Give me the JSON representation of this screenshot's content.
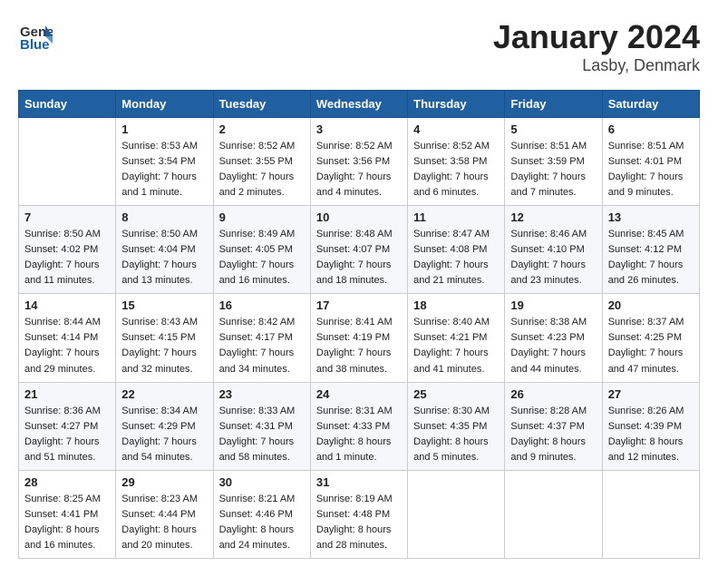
{
  "header": {
    "logo_line1": "General",
    "logo_line2": "Blue",
    "month": "January 2024",
    "location": "Lasby, Denmark"
  },
  "weekdays": [
    "Sunday",
    "Monday",
    "Tuesday",
    "Wednesday",
    "Thursday",
    "Friday",
    "Saturday"
  ],
  "weeks": [
    [
      {
        "day": "",
        "info": ""
      },
      {
        "day": "1",
        "info": "Sunrise: 8:53 AM\nSunset: 3:54 PM\nDaylight: 7 hours\nand 1 minute."
      },
      {
        "day": "2",
        "info": "Sunrise: 8:52 AM\nSunset: 3:55 PM\nDaylight: 7 hours\nand 2 minutes."
      },
      {
        "day": "3",
        "info": "Sunrise: 8:52 AM\nSunset: 3:56 PM\nDaylight: 7 hours\nand 4 minutes."
      },
      {
        "day": "4",
        "info": "Sunrise: 8:52 AM\nSunset: 3:58 PM\nDaylight: 7 hours\nand 6 minutes."
      },
      {
        "day": "5",
        "info": "Sunrise: 8:51 AM\nSunset: 3:59 PM\nDaylight: 7 hours\nand 7 minutes."
      },
      {
        "day": "6",
        "info": "Sunrise: 8:51 AM\nSunset: 4:01 PM\nDaylight: 7 hours\nand 9 minutes."
      }
    ],
    [
      {
        "day": "7",
        "info": "Sunrise: 8:50 AM\nSunset: 4:02 PM\nDaylight: 7 hours\nand 11 minutes."
      },
      {
        "day": "8",
        "info": "Sunrise: 8:50 AM\nSunset: 4:04 PM\nDaylight: 7 hours\nand 13 minutes."
      },
      {
        "day": "9",
        "info": "Sunrise: 8:49 AM\nSunset: 4:05 PM\nDaylight: 7 hours\nand 16 minutes."
      },
      {
        "day": "10",
        "info": "Sunrise: 8:48 AM\nSunset: 4:07 PM\nDaylight: 7 hours\nand 18 minutes."
      },
      {
        "day": "11",
        "info": "Sunrise: 8:47 AM\nSunset: 4:08 PM\nDaylight: 7 hours\nand 21 minutes."
      },
      {
        "day": "12",
        "info": "Sunrise: 8:46 AM\nSunset: 4:10 PM\nDaylight: 7 hours\nand 23 minutes."
      },
      {
        "day": "13",
        "info": "Sunrise: 8:45 AM\nSunset: 4:12 PM\nDaylight: 7 hours\nand 26 minutes."
      }
    ],
    [
      {
        "day": "14",
        "info": "Sunrise: 8:44 AM\nSunset: 4:14 PM\nDaylight: 7 hours\nand 29 minutes."
      },
      {
        "day": "15",
        "info": "Sunrise: 8:43 AM\nSunset: 4:15 PM\nDaylight: 7 hours\nand 32 minutes."
      },
      {
        "day": "16",
        "info": "Sunrise: 8:42 AM\nSunset: 4:17 PM\nDaylight: 7 hours\nand 34 minutes."
      },
      {
        "day": "17",
        "info": "Sunrise: 8:41 AM\nSunset: 4:19 PM\nDaylight: 7 hours\nand 38 minutes."
      },
      {
        "day": "18",
        "info": "Sunrise: 8:40 AM\nSunset: 4:21 PM\nDaylight: 7 hours\nand 41 minutes."
      },
      {
        "day": "19",
        "info": "Sunrise: 8:38 AM\nSunset: 4:23 PM\nDaylight: 7 hours\nand 44 minutes."
      },
      {
        "day": "20",
        "info": "Sunrise: 8:37 AM\nSunset: 4:25 PM\nDaylight: 7 hours\nand 47 minutes."
      }
    ],
    [
      {
        "day": "21",
        "info": "Sunrise: 8:36 AM\nSunset: 4:27 PM\nDaylight: 7 hours\nand 51 minutes."
      },
      {
        "day": "22",
        "info": "Sunrise: 8:34 AM\nSunset: 4:29 PM\nDaylight: 7 hours\nand 54 minutes."
      },
      {
        "day": "23",
        "info": "Sunrise: 8:33 AM\nSunset: 4:31 PM\nDaylight: 7 hours\nand 58 minutes."
      },
      {
        "day": "24",
        "info": "Sunrise: 8:31 AM\nSunset: 4:33 PM\nDaylight: 8 hours\nand 1 minute."
      },
      {
        "day": "25",
        "info": "Sunrise: 8:30 AM\nSunset: 4:35 PM\nDaylight: 8 hours\nand 5 minutes."
      },
      {
        "day": "26",
        "info": "Sunrise: 8:28 AM\nSunset: 4:37 PM\nDaylight: 8 hours\nand 9 minutes."
      },
      {
        "day": "27",
        "info": "Sunrise: 8:26 AM\nSunset: 4:39 PM\nDaylight: 8 hours\nand 12 minutes."
      }
    ],
    [
      {
        "day": "28",
        "info": "Sunrise: 8:25 AM\nSunset: 4:41 PM\nDaylight: 8 hours\nand 16 minutes."
      },
      {
        "day": "29",
        "info": "Sunrise: 8:23 AM\nSunset: 4:44 PM\nDaylight: 8 hours\nand 20 minutes."
      },
      {
        "day": "30",
        "info": "Sunrise: 8:21 AM\nSunset: 4:46 PM\nDaylight: 8 hours\nand 24 minutes."
      },
      {
        "day": "31",
        "info": "Sunrise: 8:19 AM\nSunset: 4:48 PM\nDaylight: 8 hours\nand 28 minutes."
      },
      {
        "day": "",
        "info": ""
      },
      {
        "day": "",
        "info": ""
      },
      {
        "day": "",
        "info": ""
      }
    ]
  ]
}
